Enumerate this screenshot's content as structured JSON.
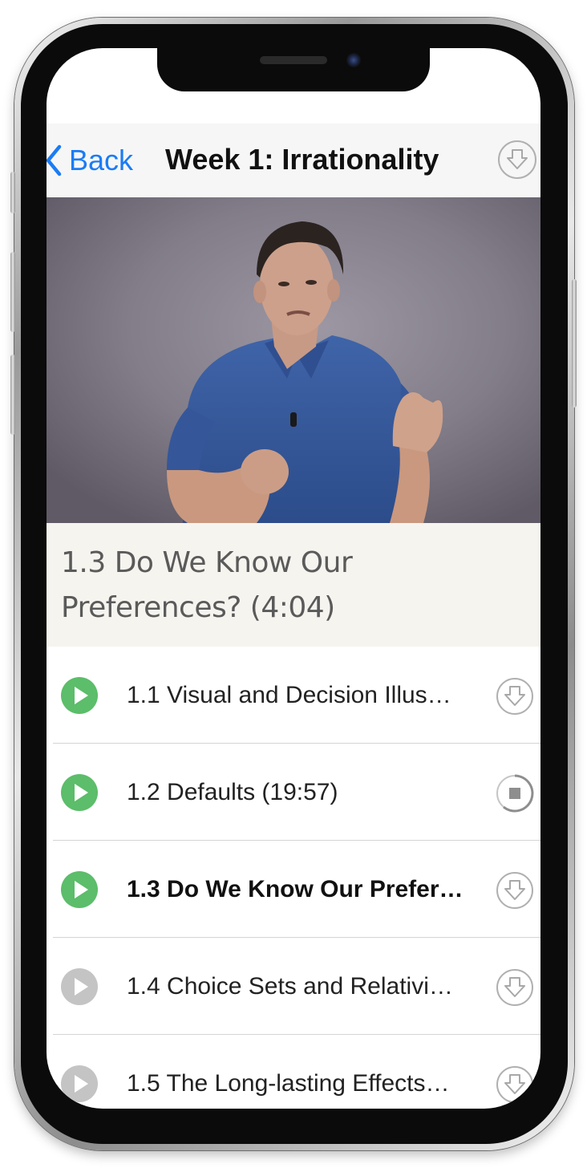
{
  "navbar": {
    "back_label": "Back",
    "title": "Week 1: Irrationality",
    "download_icon": "download-arrow-icon"
  },
  "now_playing": {
    "title": "1.3 Do We Know Our Preferences? (4:04)"
  },
  "lessons": [
    {
      "label": "1.1 Visual and Decision Illus…",
      "status": "watched",
      "action": "download",
      "active": false
    },
    {
      "label": "1.2 Defaults (19:57)",
      "status": "watched",
      "action": "downloading-stop",
      "active": false
    },
    {
      "label": "1.3 Do We Know Our Prefer…",
      "status": "watched",
      "action": "download",
      "active": true
    },
    {
      "label": "1.4 Choice Sets and Relativi…",
      "status": "unwatched",
      "action": "download",
      "active": false
    },
    {
      "label": "1.5 The Long-lasting Effects…",
      "status": "unwatched",
      "action": "download",
      "active": false
    }
  ],
  "colors": {
    "accent_blue": "#1a7cf5",
    "play_green": "#5cbd6a",
    "play_gray": "#c4c4c4",
    "icon_outline": "#b0b0b0"
  }
}
